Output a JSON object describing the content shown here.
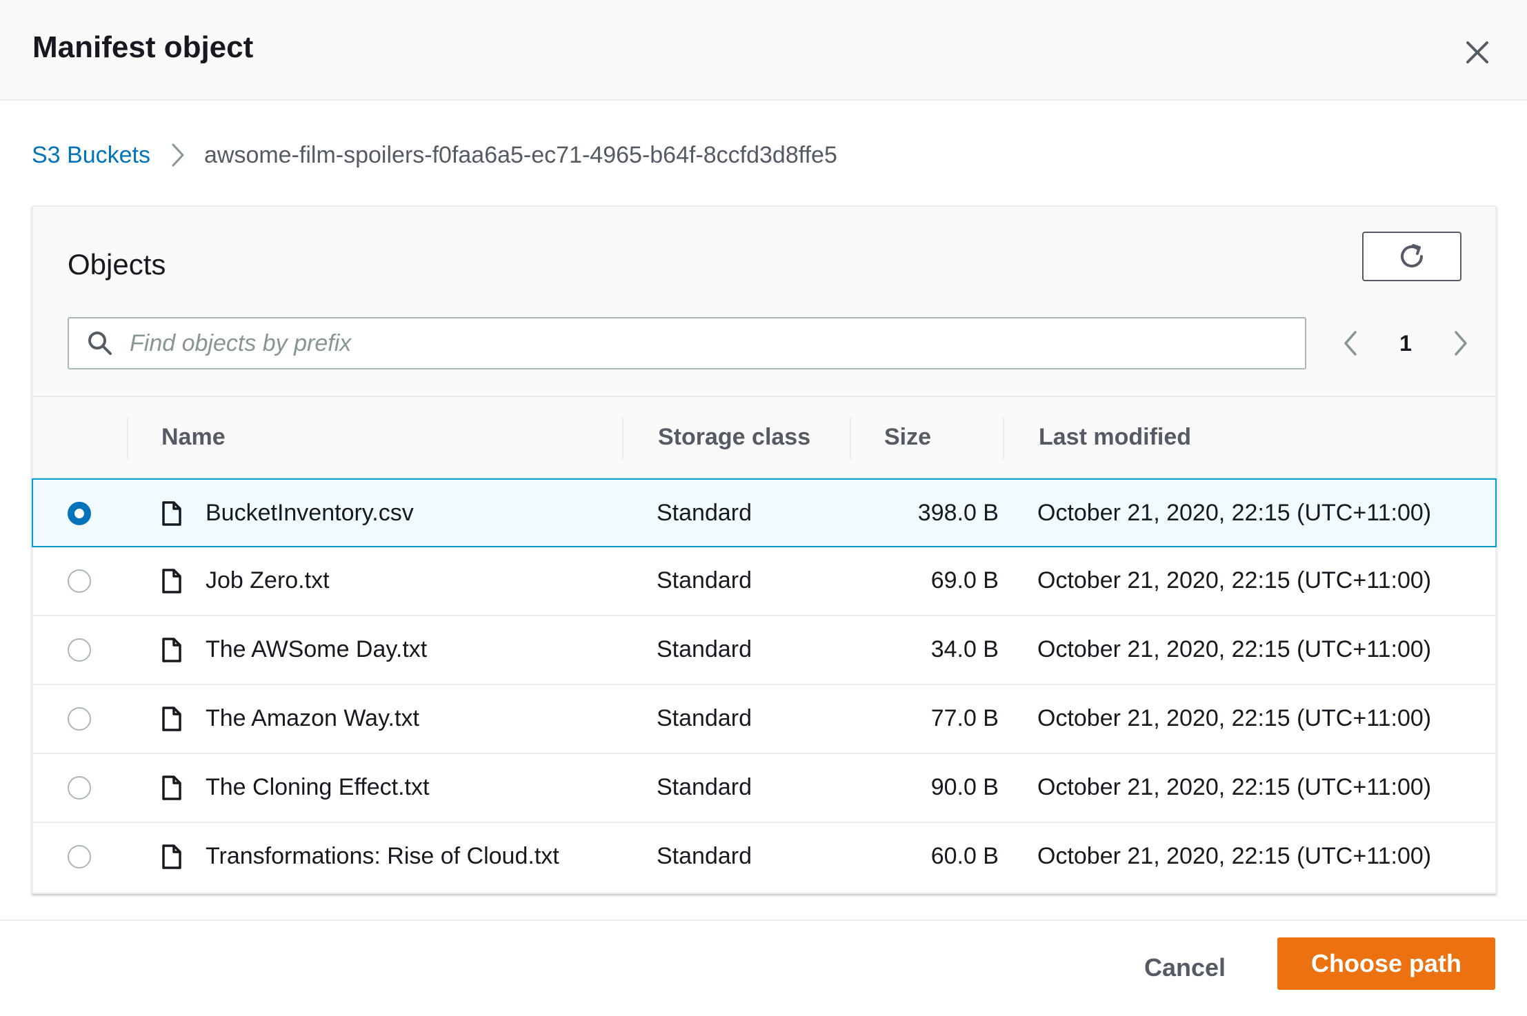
{
  "modal": {
    "title": "Manifest object"
  },
  "breadcrumb": {
    "root": "S3 Buckets",
    "current": "awsome-film-spoilers-f0faa6a5-ec71-4965-b64f-8ccfd3d8ffe5"
  },
  "objects": {
    "title": "Objects",
    "search_placeholder": "Find objects by prefix",
    "page": "1"
  },
  "table": {
    "headers": {
      "name": "Name",
      "storage_class": "Storage class",
      "size": "Size",
      "last_modified": "Last modified"
    },
    "rows": [
      {
        "name": "BucketInventory.csv",
        "storage_class": "Standard",
        "size": "398.0 B",
        "last_modified": "October 21, 2020, 22:15 (UTC+11:00)",
        "selected": true
      },
      {
        "name": "Job Zero.txt",
        "storage_class": "Standard",
        "size": "69.0 B",
        "last_modified": "October 21, 2020, 22:15 (UTC+11:00)",
        "selected": false
      },
      {
        "name": "The AWSome Day.txt",
        "storage_class": "Standard",
        "size": "34.0 B",
        "last_modified": "October 21, 2020, 22:15 (UTC+11:00)",
        "selected": false
      },
      {
        "name": "The Amazon Way.txt",
        "storage_class": "Standard",
        "size": "77.0 B",
        "last_modified": "October 21, 2020, 22:15 (UTC+11:00)",
        "selected": false
      },
      {
        "name": "The Cloning Effect.txt",
        "storage_class": "Standard",
        "size": "90.0 B",
        "last_modified": "October 21, 2020, 22:15 (UTC+11:00)",
        "selected": false
      },
      {
        "name": "Transformations: Rise of Cloud.txt",
        "storage_class": "Standard",
        "size": "60.0 B",
        "last_modified": "October 21, 2020, 22:15 (UTC+11:00)",
        "selected": false
      }
    ]
  },
  "footer": {
    "cancel_label": "Cancel",
    "choose_label": "Choose path"
  },
  "colors": {
    "primary_button": "#ec7211",
    "link": "#0073bb",
    "selected_row_bg": "#f1faff",
    "selected_row_border": "#00a1c9"
  },
  "icons": {
    "close": "close-icon",
    "breadcrumb_separator": "chevron-right-icon",
    "refresh": "refresh-icon",
    "search": "search-icon",
    "prev_page": "chevron-left-icon",
    "next_page": "chevron-right-icon",
    "file": "file-icon"
  }
}
